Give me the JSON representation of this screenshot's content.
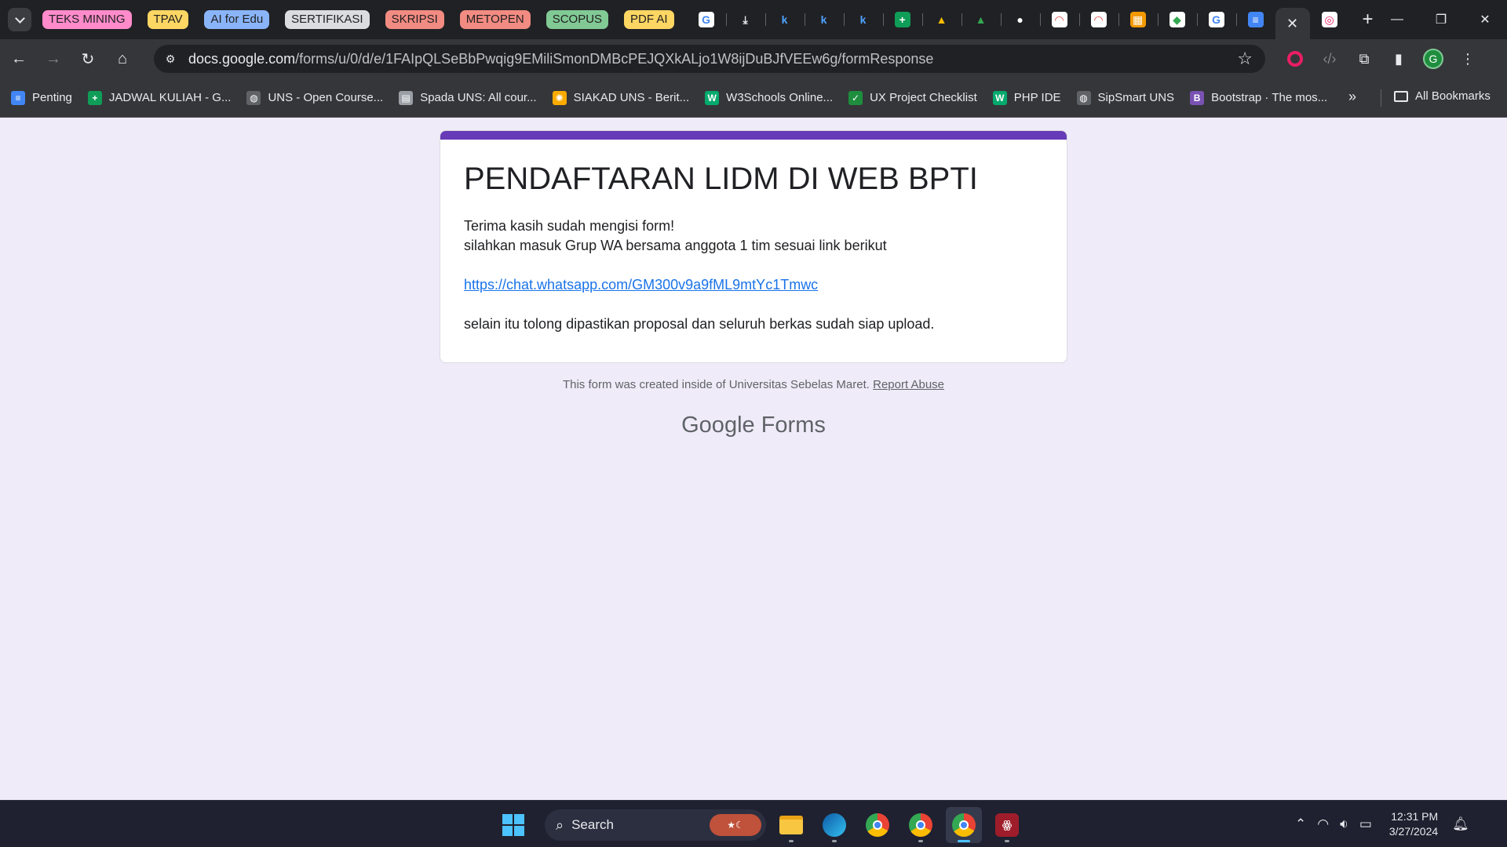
{
  "browser": {
    "tab_groups": [
      {
        "label": "TEKS MINING",
        "color": "#ff8bcb"
      },
      {
        "label": "TPAV",
        "color": "#fdd663"
      },
      {
        "label": "AI for Edu",
        "color": "#8ab4f8"
      },
      {
        "label": "SERTIFIKASI",
        "color": "#dadce0"
      },
      {
        "label": "SKRIPSI",
        "color": "#f28b82"
      },
      {
        "label": "METOPEN",
        "color": "#f28b82"
      },
      {
        "label": "SCOPUS",
        "color": "#81c995"
      },
      {
        "label": "PDF AI",
        "color": "#fdd663"
      }
    ],
    "tab_icons": [
      {
        "icon": "google-icon",
        "glyph": "G",
        "color": "#ffffff",
        "text": "#4285f4"
      },
      {
        "icon": "download-icon",
        "glyph": "⤓",
        "color": "transparent",
        "text": "#e8eaed"
      },
      {
        "icon": "k-icon",
        "glyph": "k",
        "color": "transparent",
        "text": "#4fa3ff"
      },
      {
        "icon": "k-icon",
        "glyph": "k",
        "color": "transparent",
        "text": "#4fa3ff"
      },
      {
        "icon": "k-icon",
        "glyph": "k",
        "color": "transparent",
        "text": "#4fa3ff"
      },
      {
        "icon": "sheets-icon",
        "glyph": "+",
        "color": "#0f9d58",
        "text": "#ffffff"
      },
      {
        "icon": "drive-icon",
        "glyph": "▲",
        "color": "transparent",
        "text": "#fbbc04"
      },
      {
        "icon": "drive-icon",
        "glyph": "▲",
        "color": "transparent",
        "text": "#34a853"
      },
      {
        "icon": "ninja-icon",
        "glyph": "●",
        "color": "transparent",
        "text": "#ffffff"
      },
      {
        "icon": "speedtest-icon",
        "glyph": "◠",
        "color": "#ffffff",
        "text": "#e53935"
      },
      {
        "icon": "speedtest-icon",
        "glyph": "◠",
        "color": "#ffffff",
        "text": "#e53935"
      },
      {
        "icon": "image-icon",
        "glyph": "▦",
        "color": "#f29900",
        "text": "#ffffff"
      },
      {
        "icon": "maps-icon",
        "glyph": "◆",
        "color": "#ffffff",
        "text": "#34a853"
      },
      {
        "icon": "google-icon",
        "glyph": "G",
        "color": "#ffffff",
        "text": "#4285f4"
      },
      {
        "icon": "docs-icon",
        "glyph": "≡",
        "color": "#4285f4",
        "text": "#ffffff"
      }
    ],
    "active_tab_close": "✕",
    "after_tab_icon": {
      "icon": "lens-icon",
      "glyph": "◎",
      "color": "#ffffff",
      "text": "#e91e63"
    },
    "new_tab": "+",
    "window_controls": {
      "minimize": "—",
      "restore": "❐",
      "close": "✕"
    },
    "url_host": "docs.google.com",
    "url_path": "/forms/u/0/d/e/1FAIpQLSeBbPwqig9EMiliSmonDMBcPEJQXkALjo1W8ijDuBJfVEEw6g/formResponse",
    "profile_initial": "G",
    "bookmarks": [
      {
        "label": "Penting",
        "icon": "docs-icon",
        "glyph": "≡",
        "color": "#4285f4"
      },
      {
        "label": "JADWAL KULIAH - G...",
        "icon": "sheets-icon",
        "glyph": "+",
        "color": "#0f9d58"
      },
      {
        "label": "UNS - Open Course...",
        "icon": "globe-icon",
        "glyph": "◍",
        "color": "#5f6368"
      },
      {
        "label": "Spada UNS: All cour...",
        "icon": "spada-icon",
        "glyph": "▤",
        "color": "#9aa0a6"
      },
      {
        "label": "SIAKAD UNS - Berit...",
        "icon": "siakad-icon",
        "glyph": "✺",
        "color": "#f9ab00"
      },
      {
        "label": "W3Schools Online...",
        "icon": "w3schools-icon",
        "glyph": "W",
        "color": "#04aa6d"
      },
      {
        "label": "UX Project Checklist",
        "icon": "check-icon",
        "glyph": "✓",
        "color": "#1e8e3e"
      },
      {
        "label": "PHP IDE",
        "icon": "w3schools-icon",
        "glyph": "W",
        "color": "#04aa6d"
      },
      {
        "label": "SipSmart UNS",
        "icon": "globe-icon",
        "glyph": "◍",
        "color": "#5f6368"
      },
      {
        "label": "Bootstrap · The mos...",
        "icon": "bootstrap-icon",
        "glyph": "B",
        "color": "#7952b3"
      }
    ],
    "bookmarks_more": "»",
    "all_bookmarks": "All Bookmarks"
  },
  "form": {
    "title": "PENDAFTARAN LIDM DI WEB BPTI",
    "line1": "Terima kasih sudah mengisi form!",
    "line2": "silahkan masuk Grup WA bersama anggota 1 tim sesuai link berikut",
    "link": "https://chat.whatsapp.com/GM300v9a9fML9mtYc1Tmwc",
    "line3": "selain itu tolong dipastikan proposal dan seluruh berkas sudah siap upload.",
    "footer_text": "This form was created inside of Universitas Sebelas Maret.",
    "report_abuse": "Report Abuse",
    "brand_google": "Google",
    "brand_forms": "Forms",
    "accent_color": "#673ab7"
  },
  "taskbar": {
    "search_label": "Search",
    "time": "12:31 PM",
    "date": "3/27/2024"
  }
}
